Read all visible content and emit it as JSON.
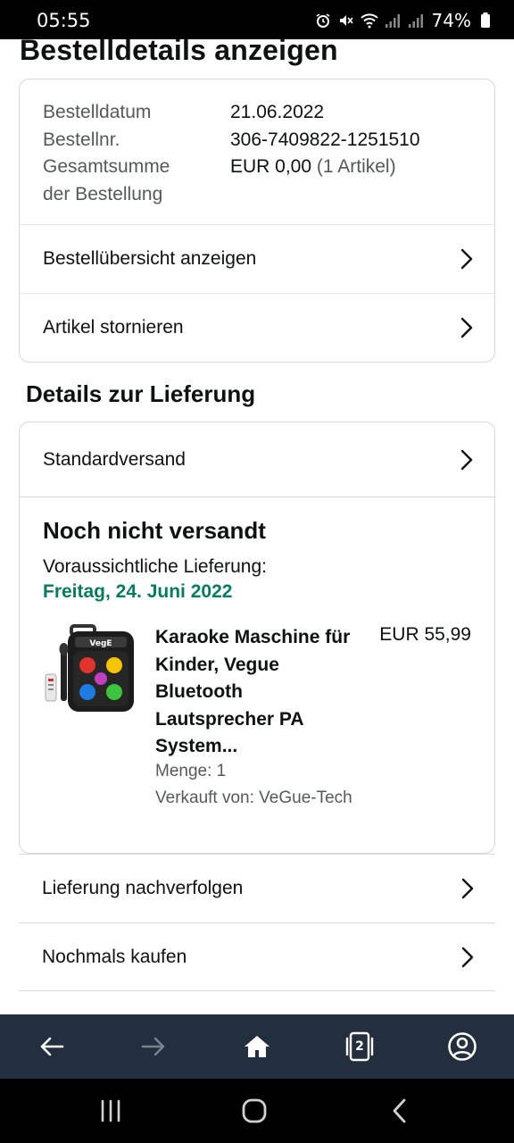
{
  "status_bar": {
    "time": "05:55",
    "battery": "74%",
    "icons": [
      "alarm-icon",
      "mute-icon",
      "wifi-icon",
      "signal-icon",
      "signal-icon",
      "battery-icon"
    ]
  },
  "page": {
    "title": "Bestelldetails anzeigen"
  },
  "order_summary": {
    "date_label": "Bestelldatum",
    "date_value": "21.06.2022",
    "number_label": "Bestellnr.",
    "number_value": "306-7409822-1251510",
    "total_label_line1": "Gesamtsumme",
    "total_label_line2": "der Bestellung",
    "total_value": "EUR 0,00",
    "total_items": "(1 Artikel)",
    "links": [
      {
        "label": "Bestellübersicht anzeigen"
      },
      {
        "label": "Artikel stornieren"
      }
    ]
  },
  "delivery": {
    "section_title": "Details zur Lieferung",
    "shipping_method": "Standardversand",
    "status": "Noch nicht versandt",
    "expected_label": "Voraussichtliche Lieferung:",
    "expected_date": "Freitag, 24. Juni 2022",
    "product": {
      "title_lines": [
        "Karaoke Maschine für",
        "Kinder, Vegue",
        "Bluetooth",
        "Lautsprecher PA",
        "System..."
      ],
      "price": "EUR 55,99",
      "quantity": "Menge: 1",
      "seller": "Verkauft von: VeGue-Tech"
    }
  },
  "actions": [
    {
      "label": "Lieferung nachverfolgen"
    },
    {
      "label": "Nochmals kaufen"
    }
  ],
  "browser_bar": {
    "tab_count": "2",
    "icons": [
      "back-arrow-icon",
      "forward-arrow-icon",
      "home-icon",
      "tabs-icon",
      "account-icon"
    ]
  },
  "colors": {
    "delivery_green": "#067d62",
    "toolbar_bg": "#232f3e",
    "border": "#d5d9d9",
    "muted_text": "#565959"
  }
}
